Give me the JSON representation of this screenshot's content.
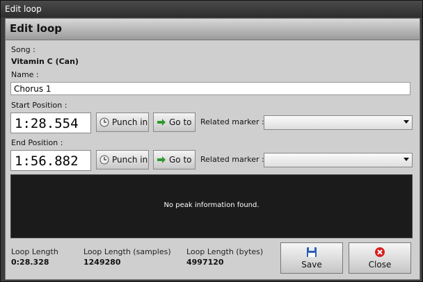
{
  "window": {
    "title": "Edit loop"
  },
  "panel": {
    "heading": "Edit loop"
  },
  "song": {
    "label": "Song :",
    "value": "Vitamin C (Can)"
  },
  "name": {
    "label": "Name :",
    "value": "Chorus 1"
  },
  "start": {
    "label": "Start Position :",
    "time": "1:28.554",
    "punch_label": "Punch in",
    "goto_label": "Go to",
    "marker_label": "Related marker :",
    "marker_value": ""
  },
  "end": {
    "label": "End Position :",
    "time": "1:56.882",
    "punch_label": "Punch in",
    "goto_label": "Go to",
    "marker_label": "Related marker :",
    "marker_value": ""
  },
  "waveform": {
    "message": "No peak information found."
  },
  "stats": {
    "length_label": "Loop Length",
    "length_value": "0:28.328",
    "samples_label": "Loop Length (samples)",
    "samples_value": "1249280",
    "bytes_label": "Loop Length (bytes)",
    "bytes_value": "4997120"
  },
  "actions": {
    "save_label": "Save",
    "close_label": "Close"
  },
  "icons": {
    "punch": "clock-icon",
    "goto": "arrow-right-icon",
    "save": "floppy-disk-icon",
    "close": "close-circle-icon"
  },
  "colors": {
    "goto_arrow": "#2e9a2e",
    "close_icon": "#d62020",
    "save_icon": "#2d5fb3"
  }
}
